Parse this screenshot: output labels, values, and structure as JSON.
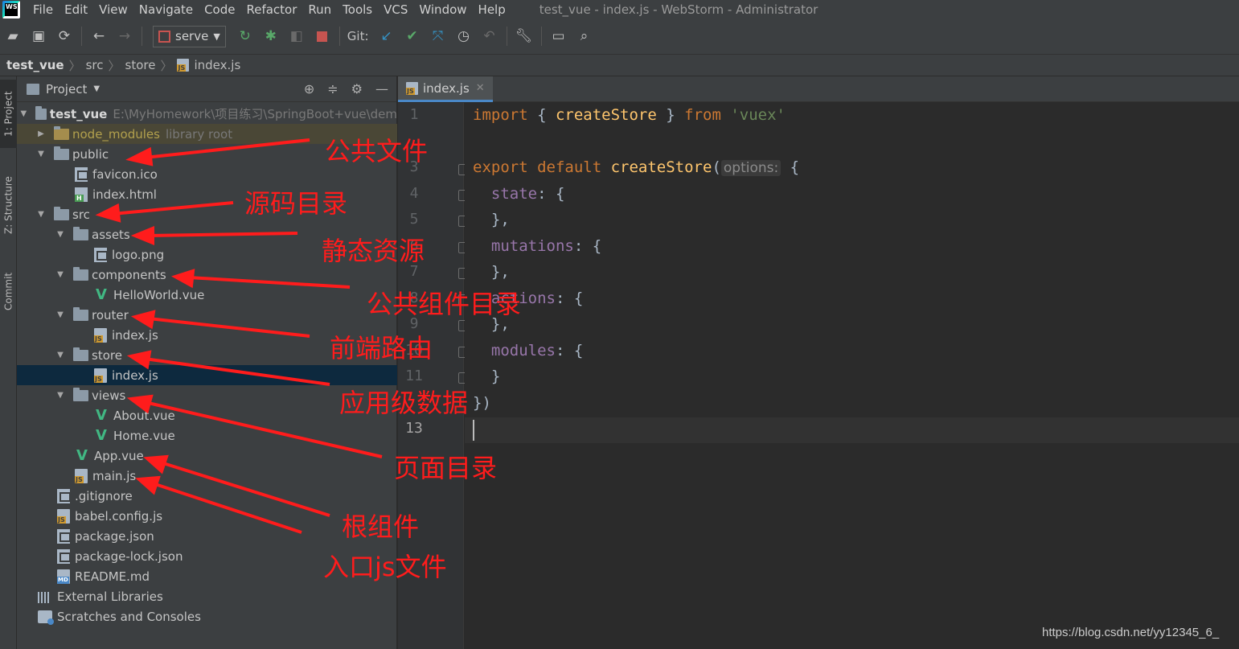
{
  "app": {
    "logo": "WS",
    "menu": [
      "File",
      "Edit",
      "View",
      "Navigate",
      "Code",
      "Refactor",
      "Run",
      "Tools",
      "VCS",
      "Window",
      "Help"
    ],
    "window_title": "test_vue - index.js - WebStorm - Administrator"
  },
  "toolbar": {
    "run_config": "serve",
    "git_label": "Git:"
  },
  "breadcrumb": {
    "project": "test_vue",
    "items": [
      "src",
      "store",
      "index.js"
    ]
  },
  "side_tabs": {
    "project": "1: Project",
    "structure": "Z: Structure",
    "commit": "Commit"
  },
  "project_panel": {
    "title": "Project",
    "root_name": "test_vue",
    "root_path": "E:\\MyHomework\\项目练习\\SpringBoot+vue\\dem",
    "node_modules": "node_modules",
    "node_modules_hint": "library root",
    "public": "public",
    "favicon": "favicon.ico",
    "index_html": "index.html",
    "src": "src",
    "assets": "assets",
    "logo": "logo.png",
    "components": "components",
    "helloworld": "HelloWorld.vue",
    "router": "router",
    "router_index": "index.js",
    "store": "store",
    "store_index": "index.js",
    "views": "views",
    "about": "About.vue",
    "home": "Home.vue",
    "app_vue": "App.vue",
    "main_js": "main.js",
    "gitignore": ".gitignore",
    "babel": "babel.config.js",
    "package": "package.json",
    "package_lock": "package-lock.json",
    "readme": "README.md",
    "external": "External Libraries",
    "scratches": "Scratches and Consoles"
  },
  "editor": {
    "tab": "index.js",
    "line_numbers": [
      "1",
      "",
      "3",
      "4",
      "5",
      "6",
      "7",
      "8",
      "9",
      "10",
      "11",
      "",
      "13"
    ],
    "code": {
      "l1_import": "import",
      "l1_brace_open": " { ",
      "l1_name": "createStore",
      "l1_brace_close": " } ",
      "l1_from": "from",
      "l1_str": " 'vuex'",
      "l3_export": "export default",
      "l3_fn": " createStore",
      "l3_paren": "(",
      "l3_hint": "options:",
      "l3_brace": " {",
      "state": "state",
      "mutations": "mutations",
      "actions": "actions",
      "modules": "modules",
      "colon_brace": ": {",
      "close_comma": "},",
      "close": "}",
      "close_paren": "})"
    }
  },
  "annotations": {
    "public": "公共文件",
    "src": "源码目录",
    "assets": "静态资源",
    "components": "公共组件目录",
    "router": "前端路由",
    "store": "应用级数据",
    "views": "页面目录",
    "root_component": "根组件",
    "entry": "入口js文件"
  },
  "watermark": "https://blog.csdn.net/yy12345_6_"
}
